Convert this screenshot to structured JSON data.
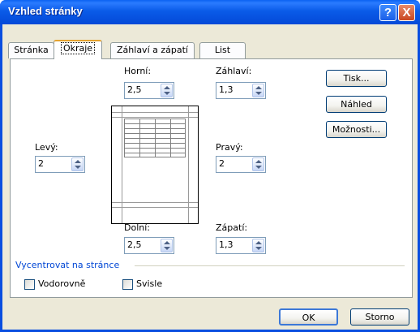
{
  "window": {
    "title": "Vzhled stránky"
  },
  "titlebar": {
    "help_glyph": "?",
    "close_glyph": "X"
  },
  "tabs": [
    {
      "label": "Stránka",
      "active": false
    },
    {
      "label": "Okraje",
      "active": true
    },
    {
      "label": "Záhlaví a zápatí",
      "active": false
    },
    {
      "label": "List",
      "active": false
    }
  ],
  "margins": {
    "top": {
      "label": "Horní:",
      "value": "2,5"
    },
    "header": {
      "label": "Záhlaví:",
      "value": "1,3"
    },
    "left": {
      "label": "Levý:",
      "value": "2"
    },
    "right": {
      "label": "Pravý:",
      "value": "2"
    },
    "bottom": {
      "label": "Dolní:",
      "value": "2,5"
    },
    "footer": {
      "label": "Zápatí:",
      "value": "1,3"
    }
  },
  "side_buttons": {
    "print": "Tisk...",
    "preview": "Náhled",
    "options": "Možnosti..."
  },
  "center": {
    "group_label": "Vycentrovat na stránce",
    "horizontal": {
      "label": "Vodorovně",
      "checked": false
    },
    "vertical": {
      "label": "Svisle",
      "checked": false
    }
  },
  "footer": {
    "ok": "OK",
    "cancel": "Storno"
  }
}
